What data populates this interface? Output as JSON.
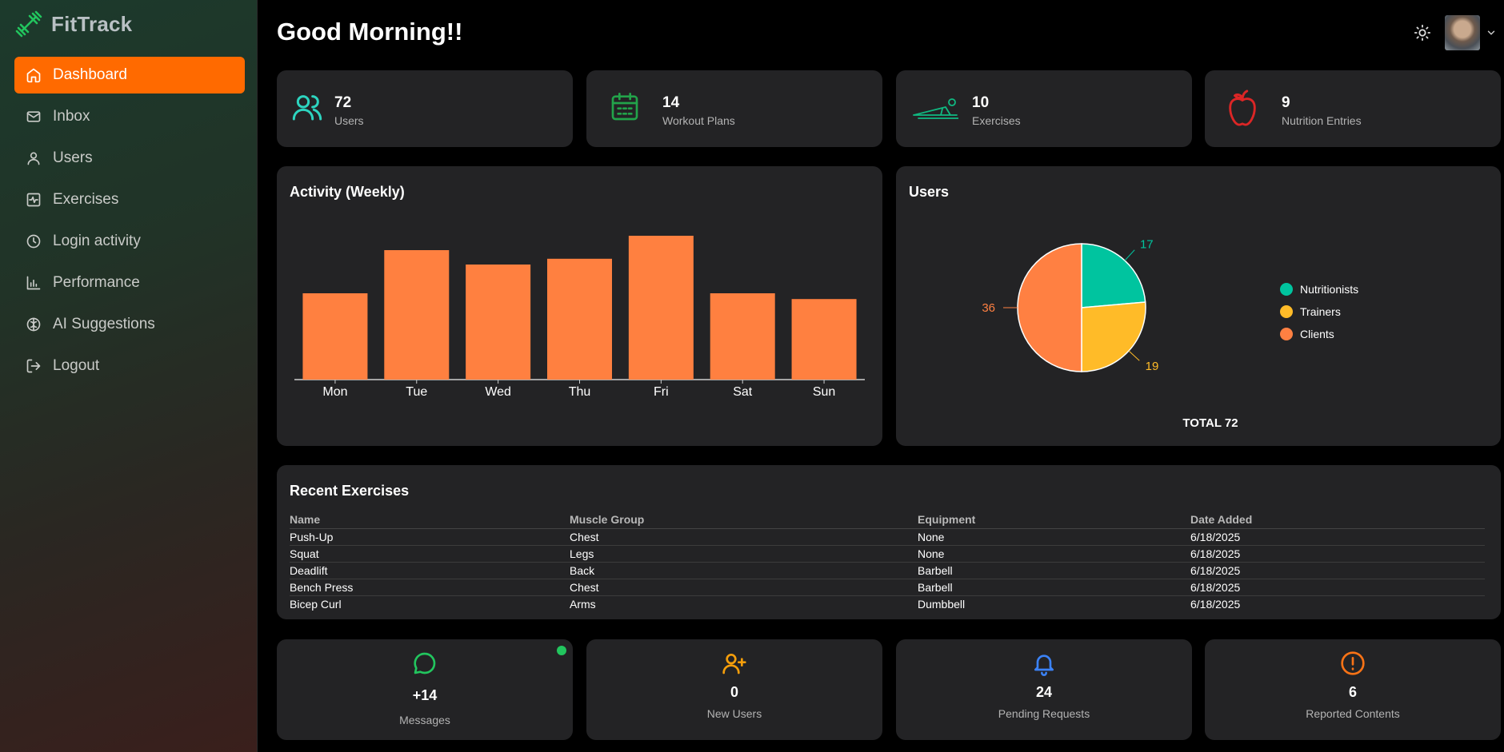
{
  "app": {
    "name": "FitTrack"
  },
  "nav": [
    {
      "label": "Dashboard",
      "icon": "home-icon",
      "active": true
    },
    {
      "label": "Inbox",
      "icon": "mail-icon"
    },
    {
      "label": "Users",
      "icon": "user-icon"
    },
    {
      "label": "Exercises",
      "icon": "activity-icon"
    },
    {
      "label": "Login activity",
      "icon": "clock-icon"
    },
    {
      "label": "Performance",
      "icon": "bar-chart-icon"
    },
    {
      "label": "AI Suggestions",
      "icon": "brain-icon"
    },
    {
      "label": "Logout",
      "icon": "logout-icon"
    }
  ],
  "header": {
    "greeting": "Good Morning!!"
  },
  "stats": [
    {
      "value": "72",
      "label": "Users",
      "icon": "users-icon",
      "color": "#2dd4bf"
    },
    {
      "value": "14",
      "label": "Workout Plans",
      "icon": "calendar-icon",
      "color": "#22a34a"
    },
    {
      "value": "10",
      "label": "Exercises",
      "icon": "pushup-icon",
      "color": "#10b981"
    },
    {
      "value": "9",
      "label": "Nutrition Entries",
      "icon": "apple-icon",
      "color": "#dc2626"
    }
  ],
  "activity": {
    "title": "Activity (Weekly)",
    "chart_data": {
      "type": "bar",
      "categories": [
        "Mon",
        "Tue",
        "Wed",
        "Thu",
        "Fri",
        "Sat",
        "Sun"
      ],
      "values": [
        60,
        90,
        80,
        84,
        100,
        60,
        56
      ],
      "color": "#ff8040",
      "ylim": [
        0,
        100
      ]
    }
  },
  "users_chart": {
    "title": "Users",
    "total_label": "TOTAL 72",
    "chart_data": {
      "type": "pie",
      "slices": [
        {
          "name": "Nutritionists",
          "value": 17,
          "color": "#00c49f"
        },
        {
          "name": "Trainers",
          "value": 19,
          "color": "#ffbb28"
        },
        {
          "name": "Clients",
          "value": 36,
          "color": "#ff8042"
        }
      ]
    }
  },
  "recent_exercises": {
    "title": "Recent Exercises",
    "columns": [
      "Name",
      "Muscle Group",
      "Equipment",
      "Date Added"
    ],
    "rows": [
      [
        "Push-Up",
        "Chest",
        "None",
        "6/18/2025"
      ],
      [
        "Squat",
        "Legs",
        "None",
        "6/18/2025"
      ],
      [
        "Deadlift",
        "Back",
        "Barbell",
        "6/18/2025"
      ],
      [
        "Bench Press",
        "Chest",
        "Barbell",
        "6/18/2025"
      ],
      [
        "Bicep Curl",
        "Arms",
        "Dumbbell",
        "6/18/2025"
      ]
    ]
  },
  "bottom_cards": [
    {
      "value": "+14",
      "label": "Messages",
      "icon": "message-icon",
      "color": "#22c55e",
      "online": true
    },
    {
      "value": "0",
      "label": "New Users",
      "icon": "user-plus-icon",
      "color": "#f59e0b"
    },
    {
      "value": "24",
      "label": "Pending Requests",
      "icon": "bell-icon",
      "color": "#3b82f6"
    },
    {
      "value": "6",
      "label": "Reported Contents",
      "icon": "alert-circle-icon",
      "color": "#f97316"
    }
  ]
}
